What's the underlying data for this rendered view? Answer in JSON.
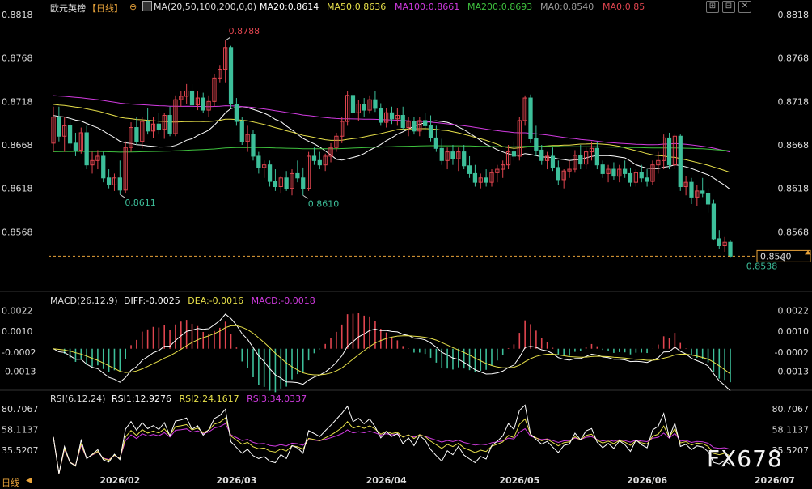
{
  "header": {
    "symbol": "欧元英镑",
    "period": "【日线】",
    "ma_label": "MA(20,50,100,200,0,0)",
    "ma20": "MA20:0.8614",
    "ma50": "MA50:0.8636",
    "ma100": "MA100:0.8661",
    "ma200": "MA200:0.8693",
    "ma0a": "MA0:0.8540",
    "ma0b": "MA0:0.85",
    "controls": [
      "⊞",
      "⊟",
      "✕",
      "⤢"
    ]
  },
  "macd_header": {
    "label": "MACD(26,12,9)",
    "diff": "DIFF:-0.0025",
    "dea": "DEA:-0.0016",
    "macd": "MACD:-0.0018"
  },
  "rsi_header": {
    "label": "RSI(6,12,24)",
    "rsi1": "RSI1:12.9276",
    "rsi2": "RSI2:24.1617",
    "rsi3": "RSI3:34.0337"
  },
  "colors": {
    "up": "#e0454f",
    "down": "#3dbf9a",
    "ma20": "#ffffff",
    "ma50": "#e8e14a",
    "ma100": "#d13be0",
    "ma200": "#3fc23f",
    "price_line": "#e8a33a",
    "grid": "#222",
    "text": "#dddddd"
  },
  "watermark": "FX678",
  "footer_label": "日线",
  "chart_data": [
    {
      "type": "candlestick",
      "title": "欧元英镑 日线",
      "ylim": [
        0.852,
        0.8818
      ],
      "y_ticks": [
        "0.8818",
        "0.8768",
        "0.8718",
        "0.8668",
        "0.8618",
        "0.8568"
      ],
      "x_ticks": [
        "2026/02",
        "2026/03",
        "2026/04",
        "2026/05",
        "2026/06",
        "2026/07"
      ],
      "x_tick_index": [
        12,
        33,
        60,
        84,
        107,
        130
      ],
      "last_price": "0.8540",
      "annotations": [
        {
          "text": "0.8788",
          "index": 31,
          "value": 0.8788
        },
        {
          "text": "0.8611",
          "index": 12,
          "value": 0.8611
        },
        {
          "text": "0.8610",
          "index": 45,
          "value": 0.861
        },
        {
          "text": "0.8538",
          "index": 131,
          "value": 0.8538
        }
      ],
      "ohlc": [
        [
          0.867,
          0.8712,
          0.866,
          0.87
        ],
        [
          0.87,
          0.8712,
          0.8672,
          0.8678
        ],
        [
          0.8678,
          0.87,
          0.866,
          0.869
        ],
        [
          0.869,
          0.8701,
          0.8664,
          0.867
        ],
        [
          0.867,
          0.8682,
          0.8655,
          0.8662
        ],
        [
          0.8662,
          0.8688,
          0.8658,
          0.8682
        ],
        [
          0.8682,
          0.869,
          0.864,
          0.8645
        ],
        [
          0.8645,
          0.866,
          0.8635,
          0.865
        ],
        [
          0.865,
          0.8662,
          0.864,
          0.8655
        ],
        [
          0.8655,
          0.866,
          0.8625,
          0.863
        ],
        [
          0.863,
          0.864,
          0.8618,
          0.8622
        ],
        [
          0.8622,
          0.8635,
          0.8615,
          0.863
        ],
        [
          0.863,
          0.865,
          0.8611,
          0.8616
        ],
        [
          0.8616,
          0.8672,
          0.8612,
          0.8665
        ],
        [
          0.8665,
          0.8694,
          0.866,
          0.8688
        ],
        [
          0.8688,
          0.87,
          0.8668,
          0.8672
        ],
        [
          0.8672,
          0.87,
          0.8664,
          0.8695
        ],
        [
          0.8695,
          0.871,
          0.868,
          0.8684
        ],
        [
          0.8684,
          0.87,
          0.8676,
          0.8692
        ],
        [
          0.8692,
          0.8705,
          0.868,
          0.8686
        ],
        [
          0.8686,
          0.8705,
          0.8675,
          0.8702
        ],
        [
          0.8702,
          0.8712,
          0.8678,
          0.8681
        ],
        [
          0.8681,
          0.8725,
          0.8678,
          0.872
        ],
        [
          0.872,
          0.873,
          0.8712,
          0.8724
        ],
        [
          0.8724,
          0.8738,
          0.8715,
          0.873
        ],
        [
          0.873,
          0.8738,
          0.871,
          0.8714
        ],
        [
          0.8714,
          0.873,
          0.8708,
          0.8722
        ],
        [
          0.8722,
          0.8728,
          0.8705,
          0.8708
        ],
        [
          0.8708,
          0.8725,
          0.87,
          0.8718
        ],
        [
          0.8718,
          0.875,
          0.8712,
          0.8745
        ],
        [
          0.8745,
          0.876,
          0.874,
          0.8755
        ],
        [
          0.8755,
          0.8788,
          0.874,
          0.878
        ],
        [
          0.878,
          0.8782,
          0.871,
          0.8715
        ],
        [
          0.8715,
          0.8722,
          0.869,
          0.8695
        ],
        [
          0.8695,
          0.87,
          0.8668,
          0.8672
        ],
        [
          0.8672,
          0.869,
          0.866,
          0.868
        ],
        [
          0.868,
          0.8685,
          0.865,
          0.8655
        ],
        [
          0.8655,
          0.866,
          0.8635,
          0.8642
        ],
        [
          0.8642,
          0.865,
          0.863,
          0.8645
        ],
        [
          0.8645,
          0.865,
          0.862,
          0.8626
        ],
        [
          0.8626,
          0.864,
          0.8615,
          0.862
        ],
        [
          0.862,
          0.8632,
          0.8612,
          0.863
        ],
        [
          0.863,
          0.8638,
          0.8615,
          0.8618
        ],
        [
          0.8618,
          0.864,
          0.861,
          0.8635
        ],
        [
          0.8635,
          0.865,
          0.8625,
          0.863
        ],
        [
          0.863,
          0.8642,
          0.861,
          0.8618
        ],
        [
          0.8618,
          0.866,
          0.8615,
          0.8655
        ],
        [
          0.8655,
          0.8665,
          0.8645,
          0.865
        ],
        [
          0.865,
          0.866,
          0.864,
          0.8645
        ],
        [
          0.8645,
          0.8658,
          0.8638,
          0.8655
        ],
        [
          0.8655,
          0.867,
          0.8648,
          0.8665
        ],
        [
          0.8665,
          0.8682,
          0.866,
          0.8678
        ],
        [
          0.8678,
          0.87,
          0.867,
          0.8695
        ],
        [
          0.8695,
          0.873,
          0.869,
          0.8725
        ],
        [
          0.8725,
          0.8728,
          0.87,
          0.8705
        ],
        [
          0.8705,
          0.872,
          0.8695,
          0.8715
        ],
        [
          0.8715,
          0.8722,
          0.87,
          0.8708
        ],
        [
          0.8708,
          0.8725,
          0.8704,
          0.872
        ],
        [
          0.872,
          0.873,
          0.8706,
          0.871
        ],
        [
          0.871,
          0.8716,
          0.869,
          0.8694
        ],
        [
          0.8694,
          0.871,
          0.8688,
          0.8705
        ],
        [
          0.8705,
          0.8712,
          0.8692,
          0.8698
        ],
        [
          0.8698,
          0.871,
          0.869,
          0.8702
        ],
        [
          0.8702,
          0.8712,
          0.8685,
          0.8688
        ],
        [
          0.8688,
          0.87,
          0.8678,
          0.8695
        ],
        [
          0.8695,
          0.87,
          0.868,
          0.8684
        ],
        [
          0.8684,
          0.87,
          0.8678,
          0.8696
        ],
        [
          0.8696,
          0.8705,
          0.8685,
          0.869
        ],
        [
          0.869,
          0.8702,
          0.8672,
          0.8676
        ],
        [
          0.8676,
          0.869,
          0.866,
          0.8664
        ],
        [
          0.8664,
          0.8675,
          0.8645,
          0.865
        ],
        [
          0.865,
          0.8665,
          0.864,
          0.866
        ],
        [
          0.866,
          0.8668,
          0.8645,
          0.8652
        ],
        [
          0.8652,
          0.8665,
          0.8638,
          0.866
        ],
        [
          0.866,
          0.8668,
          0.864,
          0.8644
        ],
        [
          0.8644,
          0.8655,
          0.863,
          0.8635
        ],
        [
          0.8635,
          0.8645,
          0.862,
          0.8625
        ],
        [
          0.8625,
          0.8635,
          0.8618,
          0.863
        ],
        [
          0.863,
          0.864,
          0.862,
          0.8625
        ],
        [
          0.8625,
          0.864,
          0.862,
          0.8636
        ],
        [
          0.8636,
          0.8645,
          0.8625,
          0.864
        ],
        [
          0.864,
          0.865,
          0.863,
          0.8645
        ],
        [
          0.8645,
          0.8668,
          0.864,
          0.866
        ],
        [
          0.866,
          0.8672,
          0.865,
          0.8655
        ],
        [
          0.8655,
          0.87,
          0.865,
          0.8696
        ],
        [
          0.8696,
          0.8725,
          0.869,
          0.8722
        ],
        [
          0.8722,
          0.8726,
          0.867,
          0.8675
        ],
        [
          0.8675,
          0.869,
          0.8655,
          0.8662
        ],
        [
          0.8662,
          0.8668,
          0.8645,
          0.865
        ],
        [
          0.865,
          0.866,
          0.864,
          0.8655
        ],
        [
          0.8655,
          0.8665,
          0.8638,
          0.8642
        ],
        [
          0.8642,
          0.865,
          0.8622,
          0.8628
        ],
        [
          0.8628,
          0.864,
          0.8618,
          0.8638
        ],
        [
          0.8638,
          0.865,
          0.863,
          0.864
        ],
        [
          0.864,
          0.8662,
          0.8636,
          0.8656
        ],
        [
          0.8656,
          0.8668,
          0.864,
          0.8646
        ],
        [
          0.8646,
          0.8665,
          0.864,
          0.866
        ],
        [
          0.866,
          0.8672,
          0.865,
          0.8664
        ],
        [
          0.8664,
          0.8672,
          0.864,
          0.8645
        ],
        [
          0.8645,
          0.865,
          0.863,
          0.8635
        ],
        [
          0.8635,
          0.8645,
          0.8625,
          0.864
        ],
        [
          0.864,
          0.8648,
          0.8628,
          0.8632
        ],
        [
          0.8632,
          0.8645,
          0.8625,
          0.864
        ],
        [
          0.864,
          0.865,
          0.863,
          0.8635
        ],
        [
          0.8635,
          0.8642,
          0.862,
          0.8625
        ],
        [
          0.8625,
          0.864,
          0.862,
          0.8636
        ],
        [
          0.8636,
          0.8645,
          0.8625,
          0.863
        ],
        [
          0.863,
          0.864,
          0.862,
          0.8626
        ],
        [
          0.8626,
          0.865,
          0.8622,
          0.8645
        ],
        [
          0.8645,
          0.866,
          0.8635,
          0.865
        ],
        [
          0.865,
          0.868,
          0.864,
          0.8676
        ],
        [
          0.8676,
          0.8682,
          0.864,
          0.8645
        ],
        [
          0.8645,
          0.868,
          0.864,
          0.8678
        ],
        [
          0.8678,
          0.868,
          0.8615,
          0.862
        ],
        [
          0.862,
          0.8632,
          0.861,
          0.8625
        ],
        [
          0.8625,
          0.863,
          0.86,
          0.8608
        ],
        [
          0.8608,
          0.8622,
          0.8598,
          0.8615
        ],
        [
          0.8615,
          0.863,
          0.8608,
          0.8612
        ],
        [
          0.8612,
          0.8618,
          0.859,
          0.86
        ],
        [
          0.86,
          0.8605,
          0.8558,
          0.856
        ],
        [
          0.856,
          0.857,
          0.8548,
          0.8552
        ],
        [
          0.8552,
          0.8562,
          0.8545,
          0.8556
        ],
        [
          0.8556,
          0.8558,
          0.8538,
          0.854
        ]
      ]
    },
    {
      "type": "bar",
      "title": "MACD(26,12,9)",
      "ylim": [
        -0.0022,
        0.0025
      ],
      "y_ticks": [
        "0.0022",
        "0.0010",
        "-0.0002",
        "-0.0013"
      ]
    },
    {
      "type": "line",
      "title": "RSI(6,12,24)",
      "ylim": [
        10,
        85
      ],
      "y_ticks": [
        "80.7067",
        "58.1137",
        "35.5207"
      ]
    }
  ]
}
